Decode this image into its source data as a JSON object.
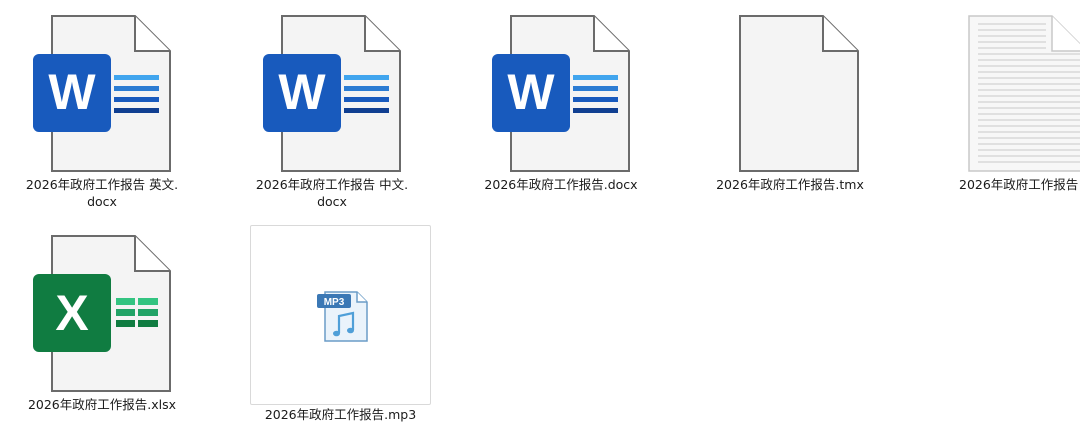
{
  "files": [
    {
      "name_line1": "2026年政府工作报告 英文.",
      "name_line2": "docx",
      "icon": "word-doc-icon"
    },
    {
      "name_line1": "2026年政府工作报告 中文.",
      "name_line2": "docx",
      "icon": "word-doc-icon"
    },
    {
      "name_line1": "2026年政府工作报告.docx",
      "name_line2": "",
      "icon": "word-doc-icon"
    },
    {
      "name_line1": "2026年政府工作报告.tmx",
      "name_line2": "",
      "icon": "blank-file-icon"
    },
    {
      "name_line1": "2026年政府工作报告",
      "name_line2": "",
      "icon": "text-file-icon"
    },
    {
      "name_line1": "2026年政府工作报告.xlsx",
      "name_line2": "",
      "icon": "excel-sheet-icon"
    },
    {
      "name_line1": "2026年政府工作报告.mp3",
      "name_line2": "",
      "icon": "mp3-audio-icon"
    }
  ],
  "icon_labels": {
    "word_letter": "W",
    "excel_letter": "X",
    "mp3_badge": "MP3"
  },
  "colors": {
    "word_blue": "#185abd",
    "word_lines": "#41a5ee",
    "excel_green": "#107c41",
    "excel_lines": "#21a366",
    "page_fill": "#f4f4f4",
    "page_stroke": "#6b6b6b",
    "mp3_blue": "#4f9fd8"
  }
}
